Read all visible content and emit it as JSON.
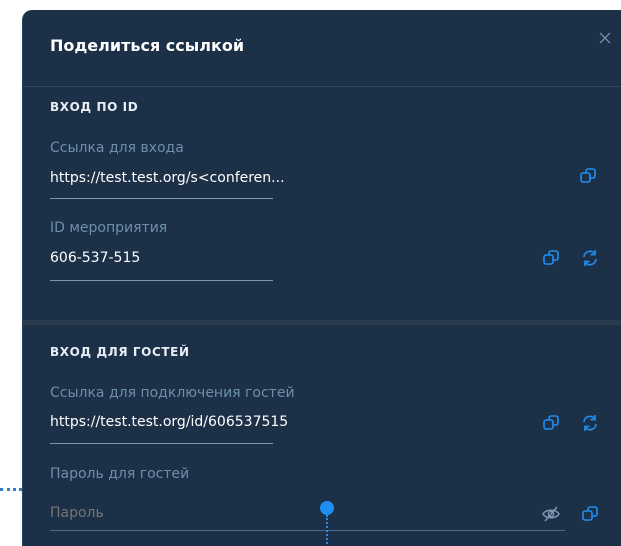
{
  "dialog": {
    "title": "Поделиться ссылкой"
  },
  "id_section": {
    "heading": "ВХОД ПО ID",
    "link_label": "Ссылка для входа",
    "link_value": "https://test.test.org/s<conferen...",
    "event_id_label": "ID мероприятия",
    "event_id_value": "606-537-515"
  },
  "guest_section": {
    "heading": "ВХОД ДЛЯ ГОСТЕЙ",
    "guest_link_label": "Ссылка для подключения гостей",
    "guest_link_value": "https://test.test.org/id/606537515",
    "password_label": "Пароль для гостей",
    "password_placeholder": "Пароль"
  },
  "colors": {
    "panel_bg": "#1c3048",
    "accent": "#1f8ef1",
    "label_muted": "#6f8eab"
  },
  "icons": [
    "close-icon",
    "copy-icon",
    "refresh-icon",
    "eye-off-icon"
  ]
}
